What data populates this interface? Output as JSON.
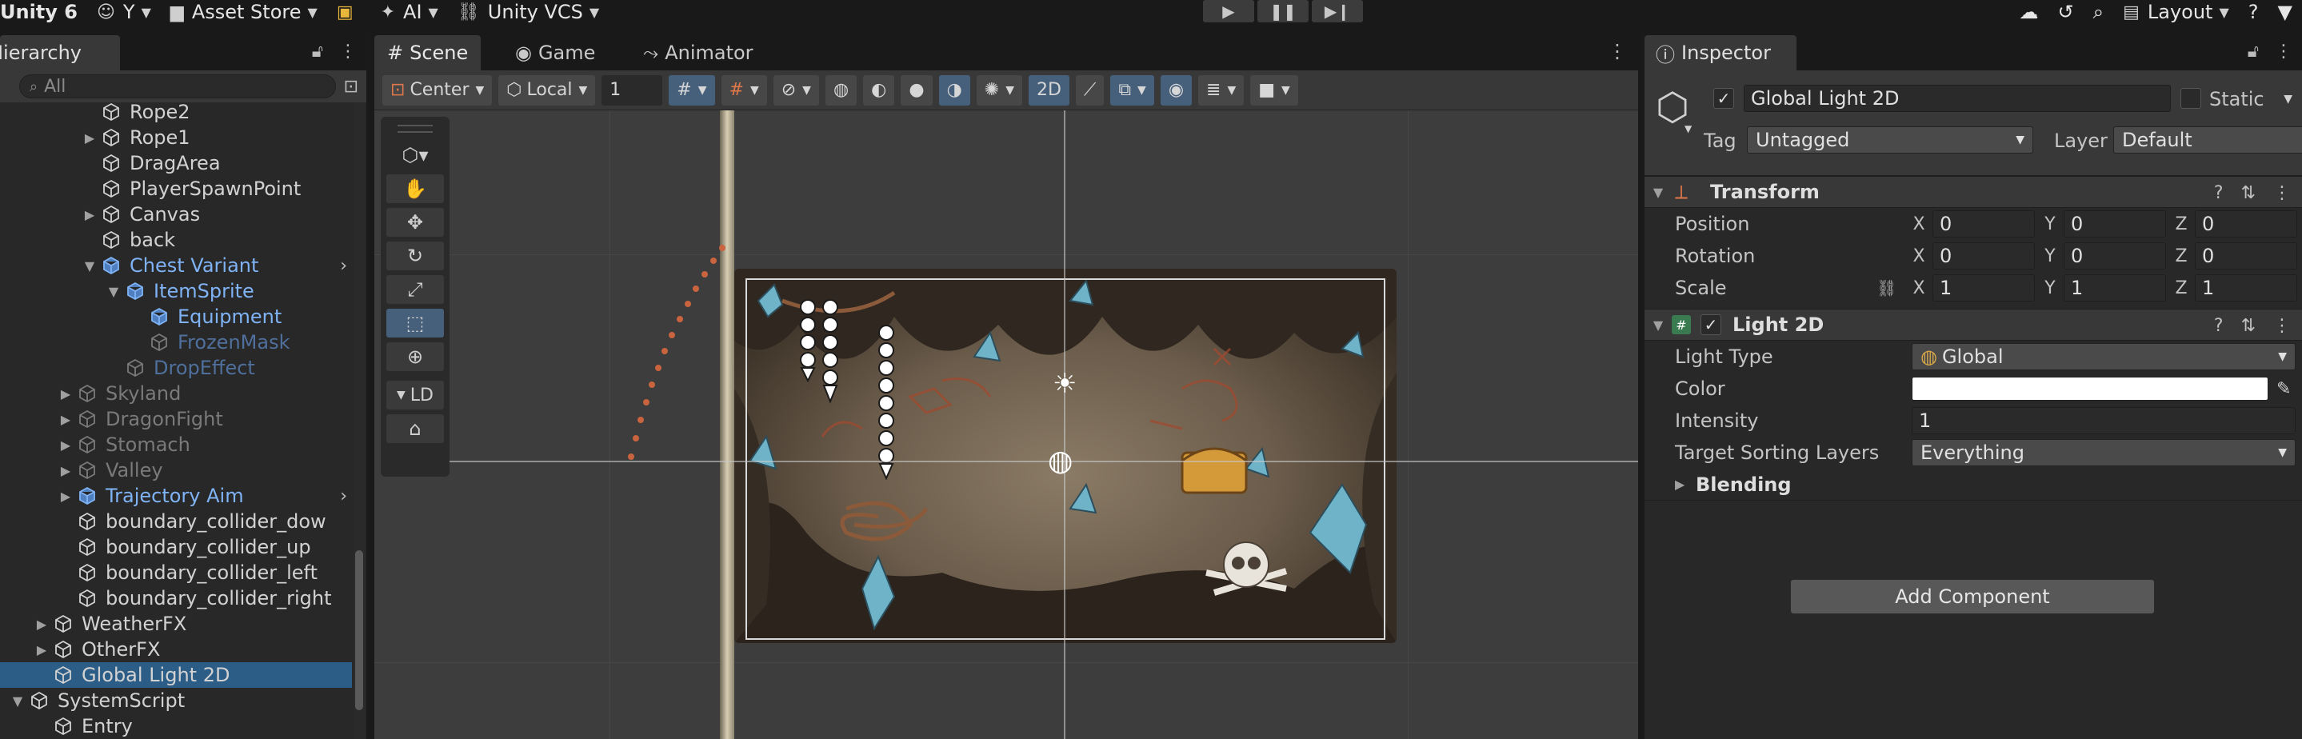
{
  "topbar": {
    "brand": "Unity 6",
    "account": "Y",
    "asset_store": "Asset Store",
    "ai": "AI",
    "vcs": "Unity VCS",
    "layout": "Layout"
  },
  "hierarchy": {
    "tab": "Hierarchy",
    "search_placeholder": "All",
    "items": [
      {
        "label": "Rope2",
        "depth": 3,
        "arrow": "",
        "style": "normal"
      },
      {
        "label": "Rope1",
        "depth": 3,
        "arrow": "▶",
        "style": "normal"
      },
      {
        "label": "DragArea",
        "depth": 3,
        "arrow": "",
        "style": "normal"
      },
      {
        "label": "PlayerSpawnPoint",
        "depth": 3,
        "arrow": "",
        "style": "normal"
      },
      {
        "label": "Canvas",
        "depth": 3,
        "arrow": "▶",
        "style": "normal"
      },
      {
        "label": "back",
        "depth": 3,
        "arrow": "",
        "style": "normal"
      },
      {
        "label": "Chest Variant",
        "depth": 3,
        "arrow": "▼",
        "style": "prefab",
        "more": "›"
      },
      {
        "label": "ItemSprite",
        "depth": 4,
        "arrow": "▼",
        "style": "prefab"
      },
      {
        "label": "Equipment",
        "depth": 5,
        "arrow": "",
        "style": "prefab"
      },
      {
        "label": "FrozenMask",
        "depth": 5,
        "arrow": "",
        "style": "dimprefab"
      },
      {
        "label": "DropEffect",
        "depth": 4,
        "arrow": "",
        "style": "dimprefab"
      },
      {
        "label": "Skyland",
        "depth": 2,
        "arrow": "▶",
        "style": "dim"
      },
      {
        "label": "DragonFight",
        "depth": 2,
        "arrow": "▶",
        "style": "dim"
      },
      {
        "label": "Stomach",
        "depth": 2,
        "arrow": "▶",
        "style": "dim"
      },
      {
        "label": "Valley",
        "depth": 2,
        "arrow": "▶",
        "style": "dim"
      },
      {
        "label": "Trajectory Aim",
        "depth": 2,
        "arrow": "▶",
        "style": "prefab",
        "more": "›"
      },
      {
        "label": "boundary_collider_dow",
        "depth": 2,
        "arrow": "",
        "style": "normal"
      },
      {
        "label": "boundary_collider_up",
        "depth": 2,
        "arrow": "",
        "style": "normal"
      },
      {
        "label": "boundary_collider_left",
        "depth": 2,
        "arrow": "",
        "style": "normal"
      },
      {
        "label": "boundary_collider_right",
        "depth": 2,
        "arrow": "",
        "style": "normal"
      },
      {
        "label": "WeatherFX",
        "depth": 1,
        "arrow": "▶",
        "style": "normal"
      },
      {
        "label": "OtherFX",
        "depth": 1,
        "arrow": "▶",
        "style": "normal"
      },
      {
        "label": "Global Light 2D",
        "depth": 1,
        "arrow": "",
        "style": "selected"
      },
      {
        "label": "SystemScript",
        "depth": 0,
        "arrow": "▼",
        "style": "normal"
      },
      {
        "label": "Entry",
        "depth": 1,
        "arrow": "",
        "style": "normal"
      }
    ]
  },
  "scene": {
    "tabs": [
      "Scene",
      "Game",
      "Animator"
    ],
    "pivot": "Center",
    "space": "Local",
    "snap_value": "1",
    "mode_2d": "2D",
    "ld": "LD"
  },
  "inspector": {
    "tab": "Inspector",
    "object_name": "Global Light 2D",
    "static_label": "Static",
    "tag_label": "Tag",
    "tag_value": "Untagged",
    "layer_label": "Layer",
    "layer_value": "Default",
    "transform": {
      "title": "Transform",
      "position_label": "Position",
      "rotation_label": "Rotation",
      "scale_label": "Scale",
      "position": [
        "0",
        "0",
        "0"
      ],
      "rotation": [
        "0",
        "0",
        "0"
      ],
      "scale": [
        "1",
        "1",
        "1"
      ]
    },
    "light2d": {
      "title": "Light 2D",
      "light_type_label": "Light Type",
      "light_type": "Global",
      "color_label": "Color",
      "intensity_label": "Intensity",
      "intensity": "1",
      "sorting_label": "Target Sorting Layers",
      "sorting": "Everything",
      "blending_label": "Blending"
    },
    "add_component": "Add Component"
  }
}
